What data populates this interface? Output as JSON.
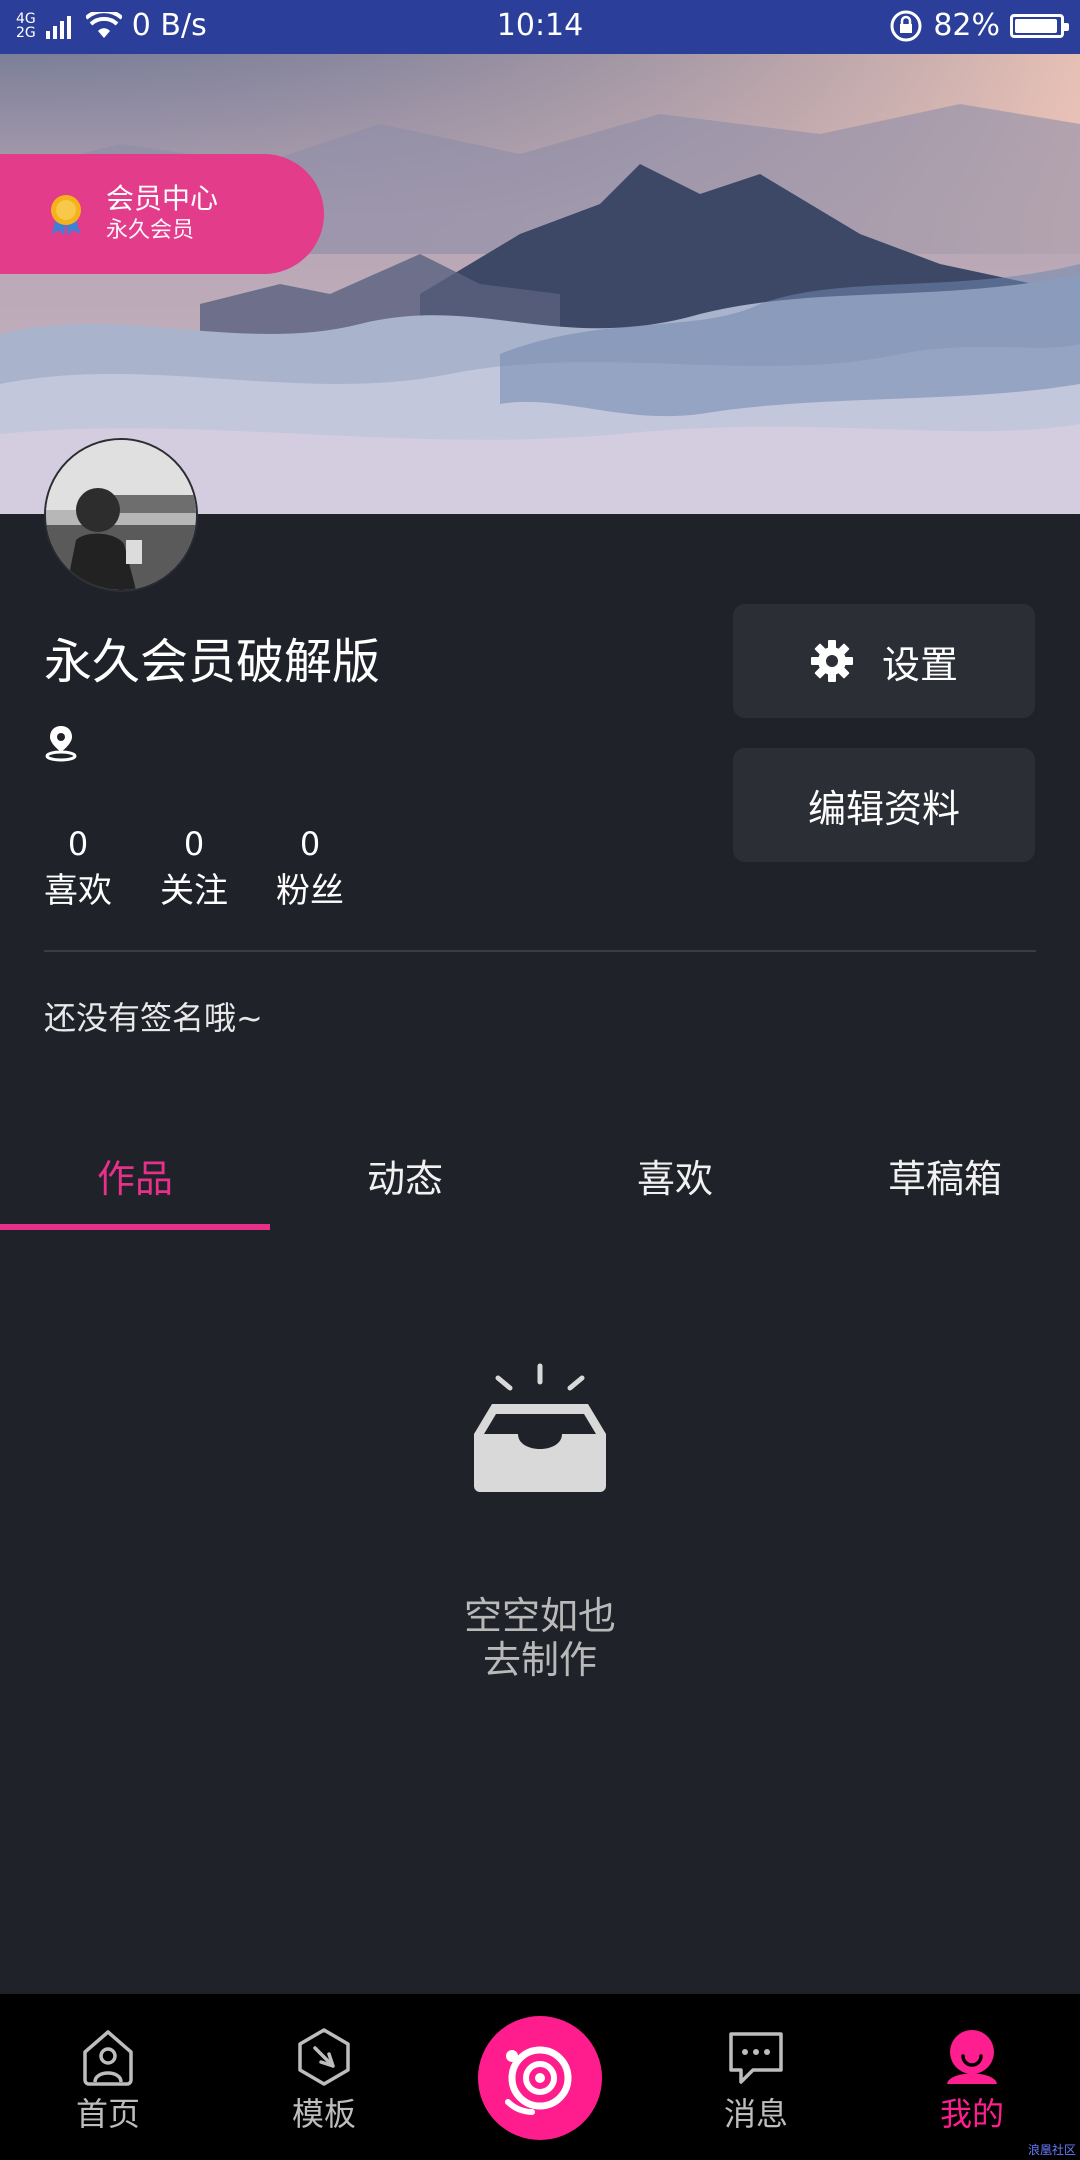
{
  "status_bar": {
    "network_top": "4G",
    "network_bottom": "2G",
    "speed": "0 B/s",
    "time": "10:14",
    "battery": "82%"
  },
  "member_badge": {
    "title": "会员中心",
    "subtitle": "永久会员"
  },
  "profile": {
    "username": "永久会员破解版",
    "settings_label": "设置",
    "edit_label": "编辑资料",
    "stats": [
      {
        "count": "0",
        "label": "喜欢"
      },
      {
        "count": "0",
        "label": "关注"
      },
      {
        "count": "0",
        "label": "粉丝"
      }
    ],
    "bio": "还没有签名哦~"
  },
  "tabs": [
    {
      "label": "作品",
      "active": true
    },
    {
      "label": "动态",
      "active": false
    },
    {
      "label": "喜欢",
      "active": false
    },
    {
      "label": "草稿箱",
      "active": false
    }
  ],
  "empty_state": {
    "title": "空空如也",
    "action": "去制作"
  },
  "bottom_nav": [
    {
      "label": "首页",
      "icon": "home-icon"
    },
    {
      "label": "模板",
      "icon": "compass-icon"
    },
    {
      "label": "",
      "icon": "camera-icon"
    },
    {
      "label": "消息",
      "icon": "message-icon"
    },
    {
      "label": "我的",
      "icon": "profile-icon",
      "active": true
    }
  ],
  "watermark": "浪凰社区",
  "colors": {
    "accent": "#e6308a",
    "status_bar": "#2b3e99",
    "background": "#1f2228",
    "nav_active": "#ff1e8f"
  }
}
